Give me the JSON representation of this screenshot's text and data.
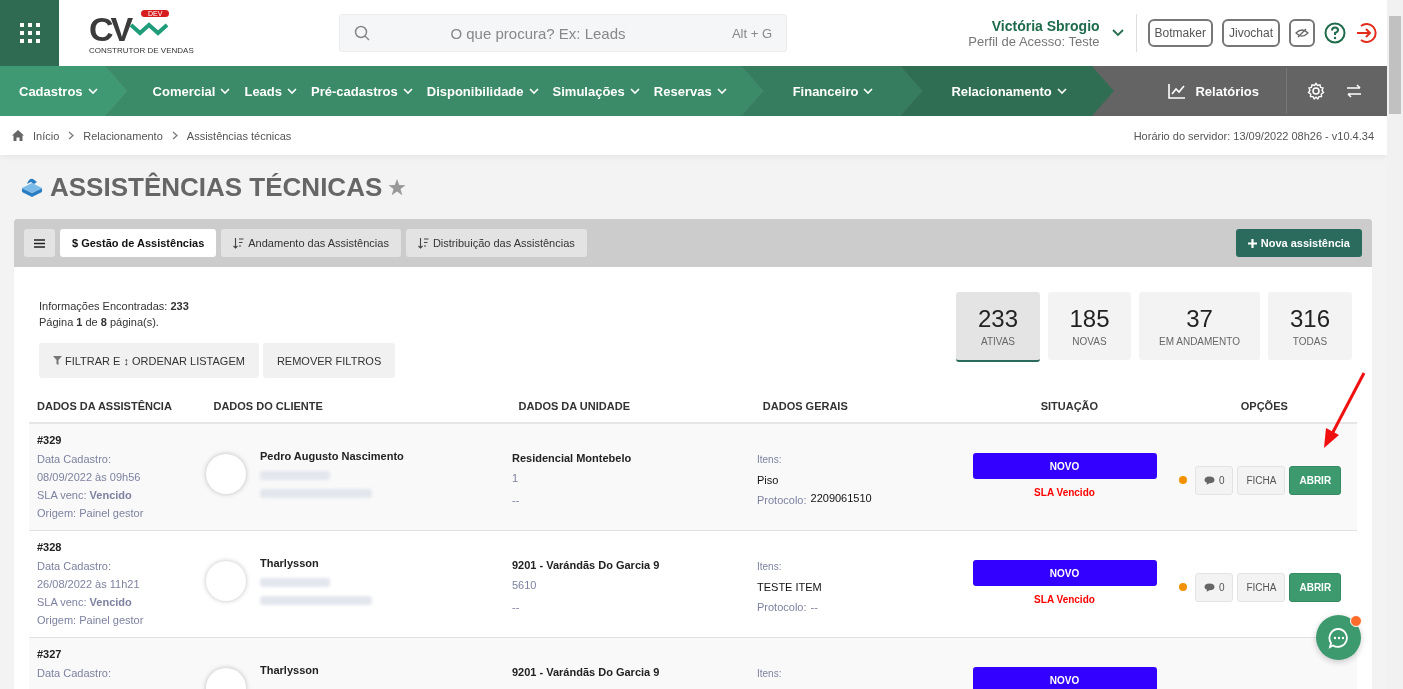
{
  "logo": {
    "mark": "CV",
    "badge": "DEV",
    "tagline": "CONSTRUTOR DE VENDAS"
  },
  "search": {
    "placeholder": "O que procura? Ex: Leads",
    "shortcut": "Alt + G"
  },
  "user": {
    "name": "Victória Sbrogio",
    "profile": "Perfil de Acesso: Teste"
  },
  "header_buttons": [
    "Botmaker",
    "Jivochat"
  ],
  "nav_segments": [
    {
      "color": "#3f9a74",
      "items": [
        "Cadastros"
      ]
    },
    {
      "color": "#3b8a68",
      "items": [
        "Comercial",
        "Leads",
        "Pré-cadastros",
        "Disponibilidade",
        "Simulações",
        "Reservas"
      ]
    },
    {
      "color": "#367d5f",
      "items": [
        "Financeiro"
      ]
    },
    {
      "color": "#2f6e53",
      "items": [
        "Relacionamento"
      ]
    }
  ],
  "reports": "Relatórios",
  "breadcrumb": [
    "Início",
    "Relacionamento",
    "Assistências técnicas"
  ],
  "server_time": "Horário do servidor: 13/09/2022 08h26 - v10.4.34",
  "page_title": "ASSISTÊNCIAS TÉCNICAS",
  "tabs": [
    {
      "label": "$ Gestão de Assistências",
      "selected": true
    },
    {
      "label": "Andamento das Assistências",
      "selected": false
    },
    {
      "label": "Distribuição das Assistências",
      "selected": false
    }
  ],
  "new_button": "Nova assistência",
  "info": [
    "Informações Encontradas: **233**",
    "Página **1** de **8** página(s)."
  ],
  "filter_buttons": [
    "FILTRAR E ↕ ORDENAR LISTAGEM",
    "REMOVER FILTROS"
  ],
  "stats": [
    {
      "value": "233",
      "label": "ATIVAS",
      "selected": true
    },
    {
      "value": "185",
      "label": "NOVAS",
      "selected": false
    },
    {
      "value": "37",
      "label": "EM ANDAMENTO",
      "selected": false
    },
    {
      "value": "316",
      "label": "TODAS",
      "selected": false
    }
  ],
  "table": {
    "columns": [
      "DADOS DA ASSISTÊNCIA",
      "DADOS DO CLIENTE",
      "DADOS DA UNIDADE",
      "DADOS GERAIS",
      "SITUAÇÃO",
      "OPÇÕES"
    ],
    "rows": [
      {
        "id": "#329",
        "date_label": "Data Cadastro:",
        "date": "08/09/2022 às 09h56",
        "sla": "SLA venc: **Vencido**",
        "origin": "Origem: Painel gestor",
        "client": "Pedro Augusto Nascimento",
        "unit": "Residencial Montebelo",
        "unit_number": "1",
        "unit_extra": "--",
        "items_label": "Itens:",
        "items": "Piso",
        "protocol_label": "Protocolo:",
        "protocol": "2209061510",
        "status": "NOVO",
        "sla_status": "SLA Vencido",
        "color": "#f39200",
        "comments": "0",
        "buttons": [
          "FICHA",
          "ABRIR"
        ]
      },
      {
        "id": "#328",
        "date_label": "Data Cadastro:",
        "date": "26/08/2022 às 11h21",
        "sla": "SLA venc: **Vencido**",
        "origin": "Origem: Painel gestor",
        "client": "Tharlysson",
        "unit": "9201 - Varándãs Do Garcia 9",
        "unit_number": "5610",
        "unit_extra": "--",
        "items_label": "Itens:",
        "items": "TESTE ITEM",
        "protocol_label": "Protocolo:",
        "protocol": "--",
        "status": "NOVO",
        "sla_status": "SLA Vencido",
        "color": "#f39200",
        "comments": "0",
        "buttons": [
          "FICHA",
          "ABRIR"
        ]
      },
      {
        "id": "#327",
        "date_label": "Data Cadastro:",
        "client": "Tharlysson",
        "unit": "9201 - Varándãs Do Garcia 9",
        "items_label": "Itens:",
        "status": "NOVO"
      }
    ]
  }
}
